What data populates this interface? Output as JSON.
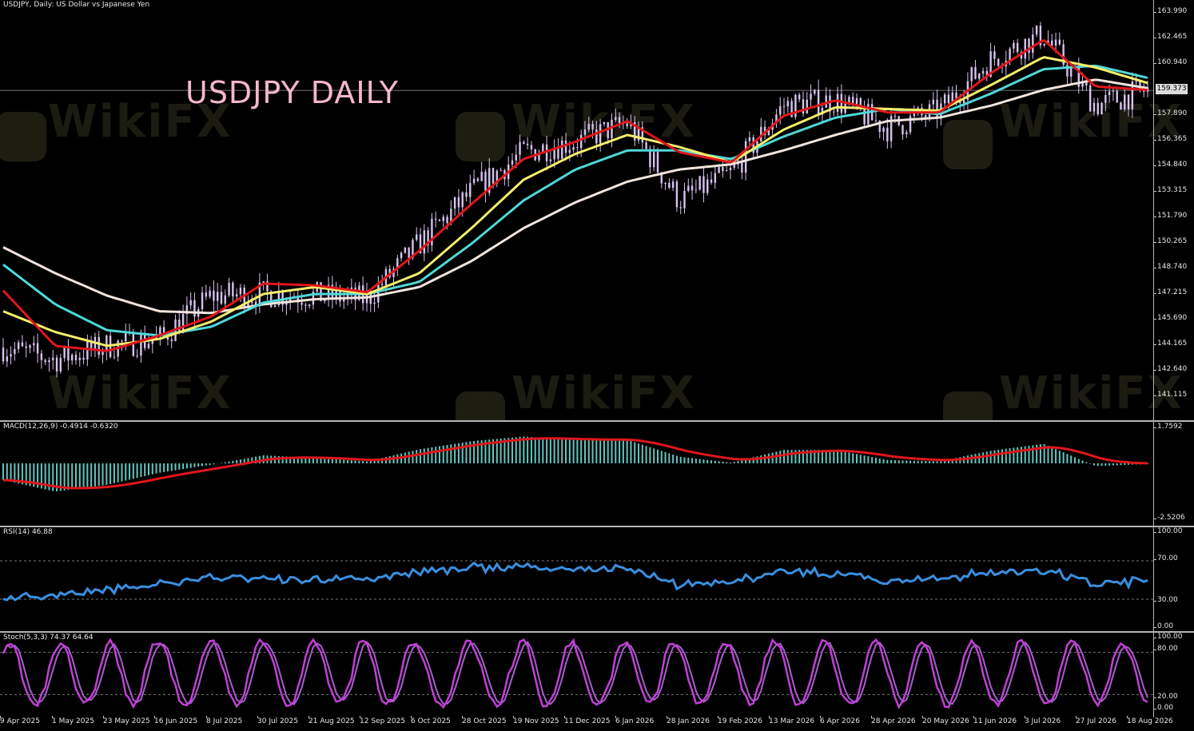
{
  "window": {
    "symbol_label": "USDJPY, Daily:  US Dollar vs Japanese Yen",
    "overlay_title": "USDJPY DAILY",
    "current_price": "159.373",
    "watermark_text": "WikiFX"
  },
  "colors": {
    "background": "#000000",
    "candle": "#d7c3ef",
    "ema_red": "#e0161b",
    "ema_yellow": "#f4ee6a",
    "ema_cyan": "#4fd8d8",
    "ema_white": "#f1e4dd",
    "macd_hist": "#63c6c0",
    "macd_signal": "#e0161b",
    "rsi": "#3a8fe0",
    "stoch_main": "#c33fd8",
    "stoch_signal": "#a460c8"
  },
  "price_axis": [
    "163.990",
    "162.465",
    "160.940",
    "159.373",
    "157.890",
    "156.365",
    "154.840",
    "153.315",
    "151.790",
    "150.265",
    "148.740",
    "147.215",
    "145.690",
    "144.165",
    "142.640",
    "141.115"
  ],
  "macd": {
    "label": "MACD(12,26,9) -0.4914 -0.6320",
    "axis": [
      "1.7592",
      "-2.5206"
    ]
  },
  "rsi": {
    "label": "RSI(14) 46.88",
    "axis": [
      "100.00",
      "70.00",
      "30.00",
      "0.00"
    ]
  },
  "stoch": {
    "label": "Stoch(5,3,3) 74.37 64.64",
    "axis": [
      "100.00",
      "80.00",
      "20.00",
      "0.00"
    ]
  },
  "date_axis": [
    "9 Apr 2025",
    "1 May 2025",
    "23 May 2025",
    "16 Jun 2025",
    "8 Jul 2025",
    "30 Jul 2025",
    "21 Aug 2025",
    "12 Sep 2025",
    "6 Oct 2025",
    "28 Oct 2025",
    "19 Nov 2025",
    "11 Dec 2025",
    "6 Jan 2026",
    "28 Jan 2026",
    "19 Feb 2026",
    "13 Mar 2026",
    "6 Apr 2026",
    "28 Apr 2026",
    "20 May 2026",
    "11 Jun 2026",
    "3 Jul 2026",
    "27 Jul 2026",
    "18 Aug 2026"
  ],
  "chart_data": {
    "type": "line",
    "title": "USDJPY DAILY",
    "xlabel": "",
    "ylabel": "",
    "ylim": [
      140.3,
      164.6
    ],
    "x": [
      "9 Apr 2025",
      "1 May 2025",
      "23 May 2025",
      "16 Jun 2025",
      "8 Jul 2025",
      "30 Jul 2025",
      "21 Aug 2025",
      "12 Sep 2025",
      "6 Oct 2025",
      "28 Oct 2025",
      "19 Nov 2025",
      "11 Dec 2025",
      "6 Jan 2026",
      "28 Jan 2026",
      "19 Feb 2026",
      "13 Mar 2026",
      "6 Apr 2026",
      "28 Apr 2026",
      "20 May 2026",
      "11 Jun 2026",
      "3 Jul 2026",
      "27 Jul 2026",
      "18 Aug 2026"
    ],
    "series": [
      {
        "name": "",
        "color": "#d7c3ef",
        "values": [
          144.5,
          143.8,
          144.6,
          145.0,
          147.5,
          147.6,
          147.5,
          147.3,
          150.5,
          153.5,
          155.8,
          156.4,
          157.5,
          153.0,
          154.6,
          158.5,
          158.8,
          157.2,
          158.2,
          161.2,
          162.6,
          158.5,
          159.4
        ]
      },
      {
        "name": "",
        "color": "#e0161b",
        "values": [
          147.8,
          144.6,
          144.3,
          145.2,
          146.3,
          148.2,
          148.1,
          147.7,
          150.1,
          152.8,
          155.4,
          156.4,
          157.6,
          155.8,
          155.2,
          157.9,
          158.8,
          158.1,
          158.1,
          160.4,
          162.3,
          159.6,
          159.4
        ]
      },
      {
        "name": "",
        "color": "#f4ee6a",
        "values": [
          146.6,
          145.4,
          144.6,
          145.0,
          146.0,
          147.6,
          148.0,
          147.6,
          148.8,
          151.4,
          154.2,
          155.7,
          156.8,
          156.1,
          155.2,
          157.1,
          158.4,
          158.3,
          158.2,
          159.7,
          161.3,
          160.7,
          159.8
        ]
      },
      {
        "name": "",
        "color": "#4fd8d8",
        "values": [
          149.3,
          147.0,
          145.5,
          145.2,
          145.7,
          147.1,
          147.6,
          147.6,
          148.3,
          150.5,
          153.0,
          154.8,
          155.9,
          155.9,
          155.4,
          156.7,
          157.8,
          158.3,
          158.0,
          159.2,
          160.6,
          160.8,
          160.1
        ]
      },
      {
        "name": "",
        "color": "#f1e4dd",
        "values": [
          150.3,
          148.8,
          147.5,
          146.6,
          146.5,
          147.0,
          147.3,
          147.4,
          148.0,
          149.5,
          151.4,
          152.9,
          154.1,
          154.8,
          155.1,
          155.9,
          156.8,
          157.6,
          157.8,
          158.5,
          159.4,
          160.0,
          159.5
        ]
      }
    ],
    "annotations": [
      "USDJPY, Daily:  US Dollar vs Japanese Yen",
      "159.373"
    ]
  }
}
